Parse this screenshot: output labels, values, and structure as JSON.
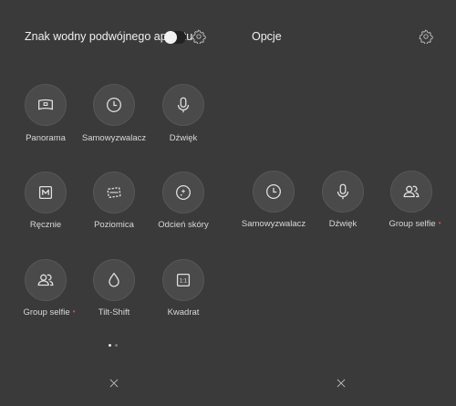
{
  "left": {
    "title": "Znak wodny podwójnego aparatu",
    "toggle_on": false,
    "items": [
      {
        "label": "Panorama",
        "icon": "panorama-icon",
        "badge": false
      },
      {
        "label": "Samowyzwalacz",
        "icon": "timer-icon",
        "badge": false
      },
      {
        "label": "Dźwięk",
        "icon": "microphone-icon",
        "badge": false
      },
      {
        "label": "Ręcznie",
        "icon": "manual-m-icon",
        "badge": false
      },
      {
        "label": "Poziomica",
        "icon": "level-icon",
        "badge": false
      },
      {
        "label": "Odcień skóry",
        "icon": "skin-tone-icon",
        "badge": false
      },
      {
        "label": "Group selfie",
        "icon": "group-icon",
        "badge": true
      },
      {
        "label": "Tilt-Shift",
        "icon": "tilt-shift-icon",
        "badge": false
      },
      {
        "label": "Kwadrat",
        "icon": "square-1-1-icon",
        "badge": false
      }
    ],
    "pager": {
      "pages": 2,
      "active": 0
    },
    "square_icon_text": "1:1"
  },
  "right": {
    "title": "Opcje",
    "items": [
      {
        "label": "Samowyzwalacz",
        "icon": "timer-icon",
        "badge": false
      },
      {
        "label": "Dźwięk",
        "icon": "microphone-icon",
        "badge": false
      },
      {
        "label": "Group selfie",
        "icon": "group-icon",
        "badge": true
      }
    ]
  },
  "badge_glyph": "•",
  "colors": {
    "background": "#3a3a3a",
    "badge": "#d9534f",
    "text": "#e6e6e6"
  }
}
